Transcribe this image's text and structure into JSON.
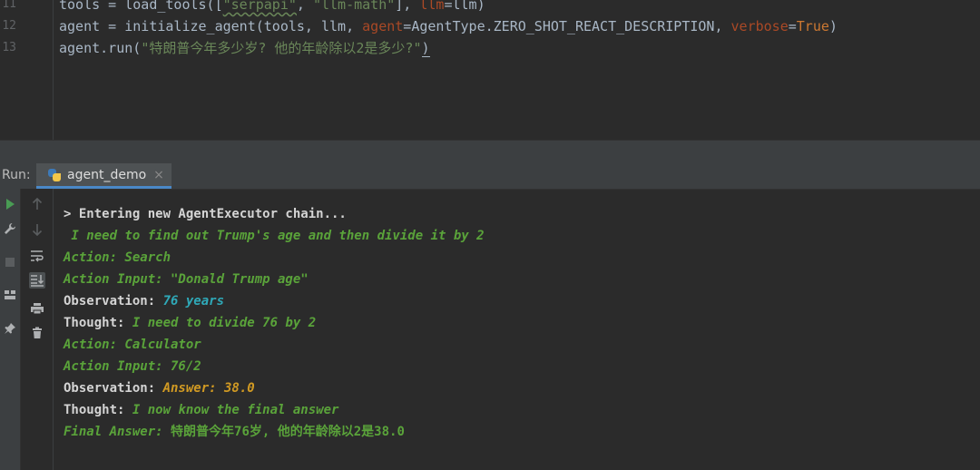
{
  "editor": {
    "line_numbers": [
      "11",
      "12",
      "13"
    ],
    "line11": {
      "p1": "tools = load_tools([",
      "s1": "\"serpapi\"",
      "p2": ", ",
      "s2": "\"llm-math\"",
      "p3": "], ",
      "kw": "llm",
      "p4": "=llm)"
    },
    "line12": {
      "p1": "agent = initialize_agent(tools, llm, ",
      "kw1": "agent",
      "p2": "=AgentType.ZERO_SHOT_REACT_DESCRIPTION, ",
      "kw2": "verbose",
      "p3": "=",
      "bool": "True",
      "p4": ")"
    },
    "line13": {
      "p1": "agent.run(",
      "s1": "\"特朗普今年多少岁? 他的年龄除以2是多少?\"",
      "p2": ")"
    }
  },
  "run_panel": {
    "label": "Run:",
    "tab_name": "agent_demo",
    "tab_close": "×",
    "tab_icon": "python-icon"
  },
  "toolbar_icons": {
    "left": [
      "run-icon",
      "wrench-icon",
      "stop-icon",
      "layout-icon",
      "pin-icon"
    ],
    "mid": [
      "arrow-up-icon",
      "arrow-down-icon",
      "soft-wrap-icon",
      "scroll-to-end-icon",
      "print-icon",
      "trash-icon"
    ]
  },
  "console": {
    "l1": "> Entering new AgentExecutor chain...",
    "l2": " I need to find out Trump's age and then divide it by 2",
    "l3": "Action: Search",
    "l4": "Action Input: \"Donald Trump age\"",
    "l5_label": "Observation: ",
    "l5_value": "76 years",
    "l6_label": "Thought: ",
    "l6_value": "I need to divide 76 by 2",
    "l7": "Action: Calculator",
    "l8": "Action Input: 76/2",
    "l9_label": "Observation: ",
    "l9_value": "Answer: 38.0",
    "l10_label": "Thought: ",
    "l10_value": "I now know the final answer",
    "l11_label": "Final Answer: ",
    "l11_value": "特朗普今年76岁, 他的年龄除以2是38.0"
  },
  "colors": {
    "background": "#2b2b2b",
    "panel": "#3c3f41",
    "string": "#6a8759",
    "keyword_param": "#aa4926",
    "bool": "#cc7832",
    "console_green": "#5aa33a",
    "console_cyan": "#2fa9b8",
    "console_yellow": "#d19a23",
    "tab_underline": "#4a88c7"
  }
}
